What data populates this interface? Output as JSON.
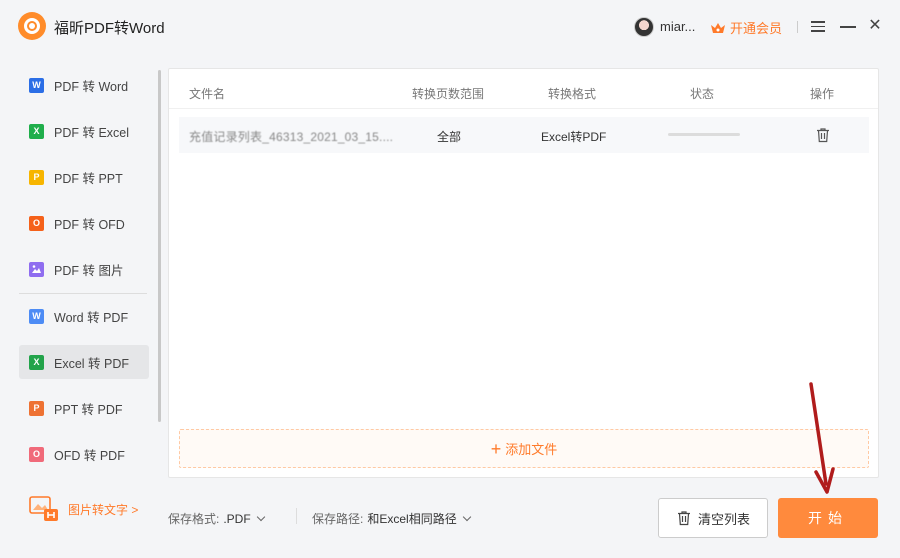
{
  "app": {
    "title": "福昕PDF转Word"
  },
  "user": {
    "name": "miar..."
  },
  "vip": {
    "label": "开通会员"
  },
  "sidebar": {
    "items": [
      {
        "label": "PDF 转 Word",
        "icon": "W",
        "color": "#2b6ee6"
      },
      {
        "label": "PDF 转 Excel",
        "icon": "X",
        "color": "#1fae4b"
      },
      {
        "label": "PDF 转 PPT",
        "icon": "P",
        "color": "#f7b500"
      },
      {
        "label": "PDF 转 OFD",
        "icon": "O",
        "color": "#f5611a"
      },
      {
        "label": "PDF 转 图片",
        "icon": "img",
        "color": "#8f6df0"
      },
      {
        "label": "Word 转 PDF",
        "icon": "W",
        "color": "#4d8cf5"
      },
      {
        "label": "Excel 转 PDF",
        "icon": "X",
        "color": "#22a34a"
      },
      {
        "label": "PPT 转 PDF",
        "icon": "P",
        "color": "#ee7233"
      },
      {
        "label": "OFD 转 PDF",
        "icon": "O",
        "color": "#f06a7a"
      }
    ],
    "active_index": 6,
    "image_to_text": "图片转文字 >"
  },
  "table": {
    "headers": {
      "filename": "文件名",
      "range": "转换页数范围",
      "format": "转换格式",
      "status": "状态",
      "action": "操作"
    },
    "rows": [
      {
        "filename": "充值记录列表_46313_2021_03_15....",
        "range": "全部",
        "format": "Excel转PDF",
        "status_progress": 0
      }
    ]
  },
  "add_file": {
    "label": "添加文件"
  },
  "bottom": {
    "save_format_label": "保存格式:",
    "save_format_value": ".PDF",
    "save_path_label": "保存路径:",
    "save_path_value": "和Excel相同路径",
    "clear_label": "清空列表",
    "start_label": "开始"
  },
  "colors": {
    "accent": "#ff8a3d",
    "arrow": "#b01c1c"
  }
}
